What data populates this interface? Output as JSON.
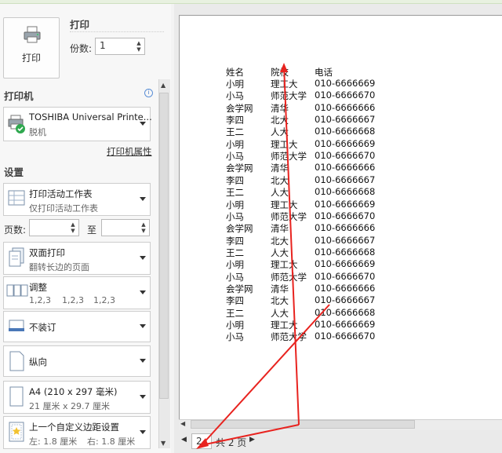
{
  "print": {
    "section_title": "打印",
    "button_label": "打印",
    "copies_label": "份数:",
    "copies_value": "1"
  },
  "printer": {
    "section_title": "打印机",
    "name": "TOSHIBA Universal Printe...",
    "status": "脱机",
    "properties_link": "打印机属性"
  },
  "settings": {
    "section_title": "设置",
    "print_scope": {
      "main": "打印活动工作表",
      "sub": "仅打印活动工作表"
    },
    "pages_label": "页数:",
    "pages_to": "至",
    "duplex": {
      "main": "双面打印",
      "sub": "翻转长边的页面"
    },
    "collate": {
      "main": "调整",
      "sub1": "1,2,3",
      "sub2": "1,2,3",
      "sub3": "1,2,3"
    },
    "staple": {
      "main": "不装订"
    },
    "orientation": {
      "main": "纵向"
    },
    "paper": {
      "main": "A4 (210 x 297 毫米)",
      "sub": "21 厘米 x 29.7 厘米"
    },
    "margins": {
      "main": "上一个自定义边距设置",
      "sub_left": "左: 1.8 厘米",
      "sub_right": "右: 1.8 厘米"
    }
  },
  "preview": {
    "headers": [
      "姓名",
      "院校",
      "电话"
    ],
    "rows": [
      [
        "小明",
        "理工大",
        "010-6666669"
      ],
      [
        "小马",
        "师范大学",
        "010-6666670"
      ],
      [
        "会学网",
        "清华",
        "010-6666666"
      ],
      [
        "李四",
        "北大",
        "010-6666667"
      ],
      [
        "王二",
        "人大",
        "010-6666668"
      ],
      [
        "小明",
        "理工大",
        "010-6666669"
      ],
      [
        "小马",
        "师范大学",
        "010-6666670"
      ],
      [
        "会学网",
        "清华",
        "010-6666666"
      ],
      [
        "李四",
        "北大",
        "010-6666667"
      ],
      [
        "王二",
        "人大",
        "010-6666668"
      ],
      [
        "小明",
        "理工大",
        "010-6666669"
      ],
      [
        "小马",
        "师范大学",
        "010-6666670"
      ],
      [
        "会学网",
        "清华",
        "010-6666666"
      ],
      [
        "李四",
        "北大",
        "010-6666667"
      ],
      [
        "王二",
        "人大",
        "010-6666668"
      ],
      [
        "小明",
        "理工大",
        "010-6666669"
      ],
      [
        "小马",
        "师范大学",
        "010-6666670"
      ],
      [
        "会学网",
        "清华",
        "010-6666666"
      ],
      [
        "李四",
        "北大",
        "010-6666667"
      ],
      [
        "王二",
        "人大",
        "010-6666668"
      ],
      [
        "小明",
        "理工大",
        "010-6666669"
      ],
      [
        "小马",
        "师范大学",
        "010-6666670"
      ]
    ],
    "current_page": "2",
    "total_pages": "共 2 页"
  },
  "colors": {
    "annotation_arrow": "#e8231f",
    "accent_green": "#2fa84f"
  },
  "icons": [
    "printer-icon",
    "info-icon",
    "printer-status-ok-icon",
    "worksheet-icon",
    "duplex-icon",
    "collate-icon",
    "staple-icon",
    "portrait-icon",
    "paper-size-icon",
    "margins-icon",
    "prev-page-icon",
    "next-page-icon"
  ]
}
